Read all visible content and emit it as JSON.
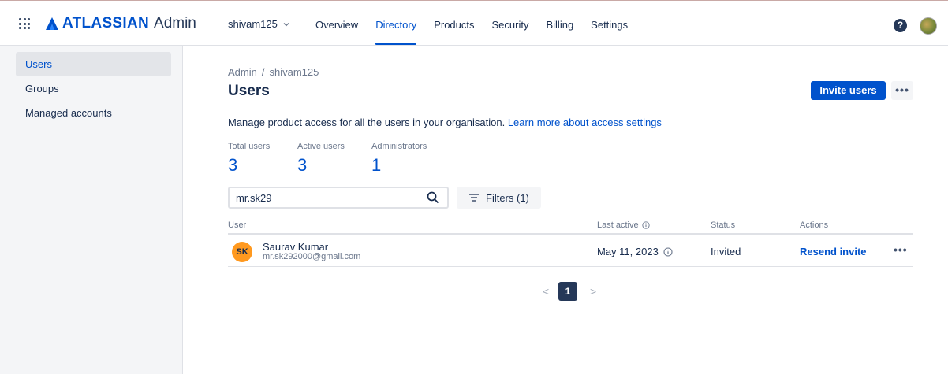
{
  "header": {
    "logo_text": "ATLASSIAN",
    "logo_suffix": "Admin",
    "org_name": "shivam125",
    "nav": [
      {
        "label": "Overview",
        "active": false
      },
      {
        "label": "Directory",
        "active": true
      },
      {
        "label": "Products",
        "active": false
      },
      {
        "label": "Security",
        "active": false
      },
      {
        "label": "Billing",
        "active": false
      },
      {
        "label": "Settings",
        "active": false
      }
    ],
    "help_glyph": "?",
    "brand_color": "#0052cc"
  },
  "sidebar": {
    "items": [
      {
        "label": "Users",
        "active": true
      },
      {
        "label": "Groups",
        "active": false
      },
      {
        "label": "Managed accounts",
        "active": false
      }
    ]
  },
  "main": {
    "breadcrumb": [
      "Admin",
      "shivam125"
    ],
    "breadcrumb_separator": "/",
    "title": "Users",
    "invite_label": "Invite users",
    "more_label": "•••",
    "description": "Manage product access for all the users in your organisation.",
    "description_link": "Learn more about access settings",
    "stats": [
      {
        "label": "Total users",
        "value": "3"
      },
      {
        "label": "Active users",
        "value": "3"
      },
      {
        "label": "Administrators",
        "value": "1"
      }
    ],
    "search_value": "mr.sk29",
    "filters_label": "Filters (1)"
  },
  "table": {
    "columns": [
      "User",
      "Last active",
      "Status",
      "Actions"
    ],
    "rows": [
      {
        "initials": "SK",
        "name": "Saurav Kumar",
        "email": "mr.sk292000@gmail.com",
        "last_active": "May 11, 2023",
        "status": "Invited",
        "action": "Resend invite",
        "more": "•••"
      }
    ]
  },
  "pagination": {
    "prev": "<",
    "current_page": "1",
    "next": ">"
  }
}
